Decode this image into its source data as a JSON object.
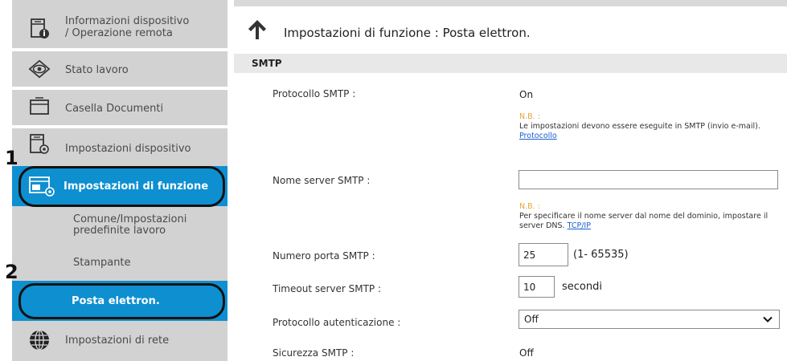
{
  "sidebar": {
    "items": [
      {
        "label_line1": "Informazioni dispositivo",
        "label_line2": "/ Operazione remota",
        "icon": "device-info-icon"
      },
      {
        "label": "Stato lavoro",
        "icon": "eye-icon"
      },
      {
        "label": "Casella Documenti",
        "icon": "folder-icon"
      },
      {
        "label": "Impostazioni dispositivo",
        "icon": "device-settings-icon"
      },
      {
        "label": "Impostazioni di funzione",
        "icon": "function-settings-icon"
      }
    ],
    "subitems": [
      {
        "label_line1": "Comune/Impostazioni",
        "label_line2": "predefinite lavoro"
      },
      {
        "label": "Stampante"
      },
      {
        "label": "Posta elettron."
      }
    ],
    "network": {
      "label": "Impostazioni di rete",
      "icon": "globe-icon"
    }
  },
  "callouts": {
    "one": "1",
    "two": "2"
  },
  "header": {
    "title": "Impostazioni di funzione : Posta elettron."
  },
  "section": {
    "title": "SMTP"
  },
  "form": {
    "smtp_protocol": {
      "label": "Protocollo SMTP :",
      "value": "On"
    },
    "note1": {
      "nb": "N.B. :",
      "text": "Le impostazioni devono essere eseguite in SMTP (invio e-mail).",
      "link": "Protocollo"
    },
    "server_name": {
      "label": "Nome server SMTP :",
      "value": ""
    },
    "note2": {
      "nb": "N.B. :",
      "text": "Per specificare il nome server dal nome del dominio, impostare il server DNS.",
      "link": "TCP/IP"
    },
    "port": {
      "label": "Numero porta SMTP :",
      "value": "25",
      "range": "(1- 65535)"
    },
    "timeout": {
      "label": "Timeout server SMTP :",
      "value": "10",
      "unit": "secondi"
    },
    "auth": {
      "label": "Protocollo autenticazione :",
      "selected": "Off"
    },
    "security": {
      "label": "Sicurezza SMTP :",
      "value": "Off"
    }
  },
  "colors": {
    "active": "#0e8fd0",
    "sidebar_bg": "#d2d2d2",
    "nb": "#e8a33a",
    "link": "#1a5fd0"
  }
}
